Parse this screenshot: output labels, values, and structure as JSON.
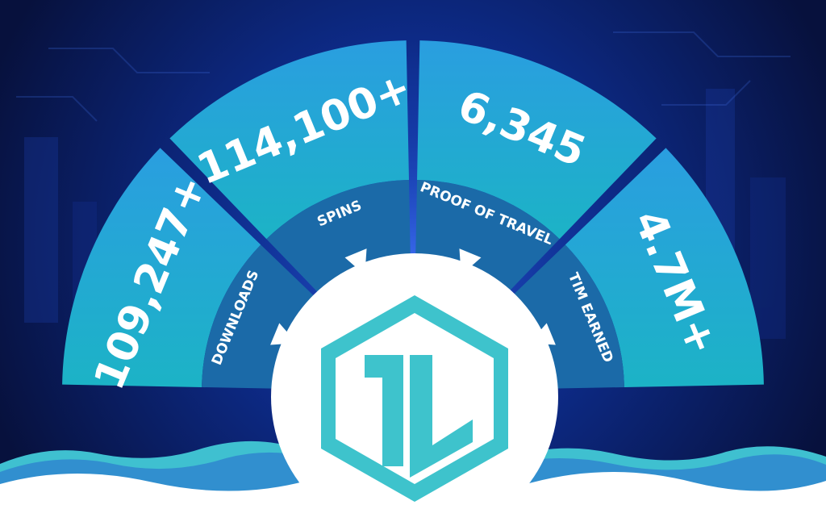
{
  "stats": [
    {
      "value": "109,247+",
      "label": "DOWNLOADS"
    },
    {
      "value": "114,100+",
      "label": "SPINS"
    },
    {
      "value": "6,345",
      "label": "PROOF OF TRAVEL"
    },
    {
      "value": "4.7M+",
      "label": "TIM EARNED"
    }
  ],
  "logo": {
    "name": "hexagon-logo",
    "accent_color": "#3ec3cc"
  },
  "colors": {
    "background": "#0a1a4e",
    "segment_outer_top": "#2a9ee0",
    "segment_outer_bottom": "#1cb3c6",
    "segment_inner": "#1b6aa8",
    "wave_light": "#3fc0d0",
    "wave_dark": "#2f86cf",
    "white": "#ffffff"
  }
}
